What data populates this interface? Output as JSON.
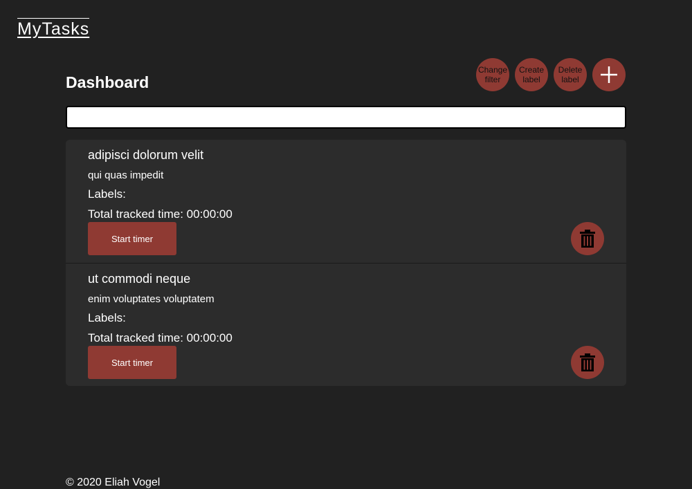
{
  "header": {
    "brand": "MyTasks"
  },
  "dashboard": {
    "title": "Dashboard",
    "actions": {
      "change_filter": "Change\nfilter",
      "create_label": "Create\nlabel",
      "delete_label": "Delete\nlabel",
      "add": "+"
    },
    "search": {
      "value": "",
      "placeholder": ""
    }
  },
  "tasks": [
    {
      "title": "adipisci dolorum velit",
      "description": "qui quas impedit",
      "labels": "Labels:",
      "tracked_time": "Total tracked time: 00:00:00",
      "start_label": "Start timer",
      "delete_icon": "trash-icon"
    },
    {
      "title": "ut commodi neque",
      "description": "enim voluptates voluptatem",
      "labels": "Labels:",
      "tracked_time": "Total tracked time: 00:00:00",
      "start_label": "Start timer",
      "delete_icon": "trash-icon"
    }
  ],
  "footer": {
    "copyright": "© 2020 Eliah Vogel"
  },
  "colors": {
    "background": "#212121",
    "card": "#2c2c2c",
    "accent": "#8f3a33"
  }
}
